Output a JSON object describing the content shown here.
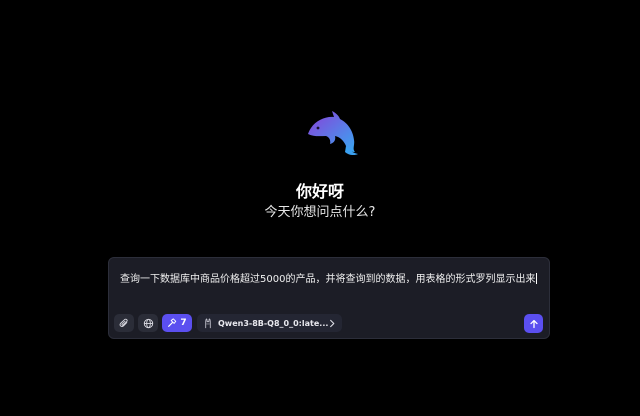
{
  "brand": {
    "logo_icon": "dolphin-icon",
    "gradient_from": "#7b4fd6",
    "gradient_to": "#3aa0f0"
  },
  "hero": {
    "greeting": "你好呀",
    "subtitle": "今天你想问点什么?"
  },
  "composer": {
    "input_value": "查询一下数据库中商品价格超过5000的产品，并将查询到的数据，用表格的形式罗列显示出来",
    "toolbar": {
      "attach_icon": "paperclip-icon",
      "web_icon": "globe-icon",
      "tools_icon": "hammer-icon",
      "tools_count": "7",
      "model_icon": "llama-icon",
      "model_name": "Qwen3-8B-Q8_0_0:late...",
      "model_chevron_icon": "chevron-right-icon",
      "send_icon": "arrow-up-icon"
    },
    "accent_color": "#5b4ff0"
  }
}
